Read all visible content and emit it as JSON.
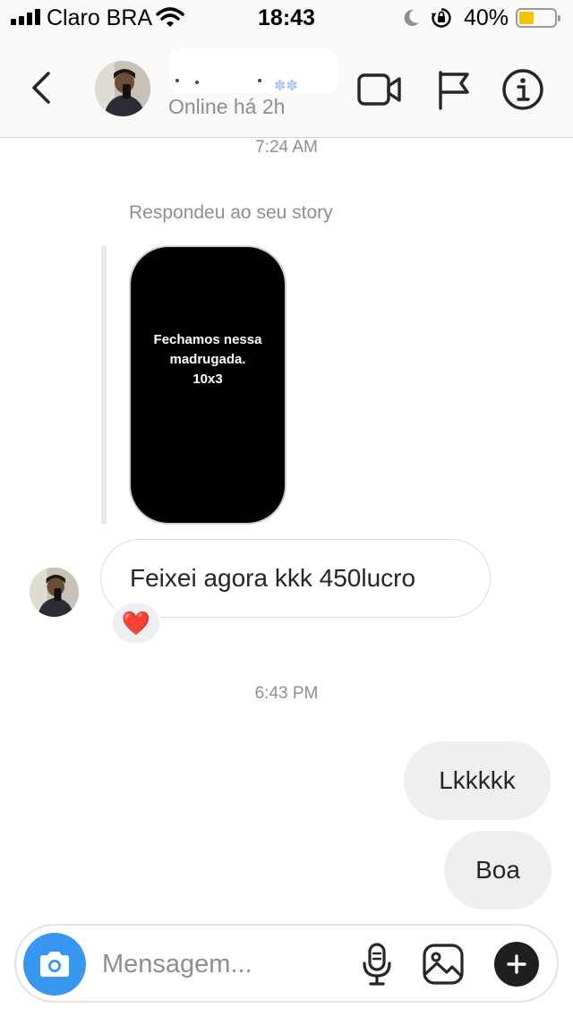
{
  "status_bar": {
    "carrier": "Claro BRA",
    "time": "18:43",
    "battery_percent": "40%",
    "battery_level": 0.4,
    "battery_color": "#f5c400",
    "icons": [
      "signal-icon",
      "wifi-icon",
      "moon-icon",
      "orientation-lock-icon",
      "battery-icon"
    ]
  },
  "header": {
    "presence": "Online há 2h",
    "icons": [
      "chevron-left-icon",
      "video-camera-icon",
      "flag-icon",
      "info-icon"
    ]
  },
  "chat": {
    "timestamp_1": "7:24 AM",
    "story_reply_label": "Respondeu ao seu story",
    "story_text": "Fechamos nessa\nmadrugada.\n10x3",
    "incoming_message": "Feixei agora kkk 450lucro",
    "reaction": "❤️",
    "timestamp_2": "6:43 PM",
    "outgoing_messages": [
      "Lkkkkk",
      "Boa"
    ]
  },
  "composer": {
    "placeholder": "Mensagem...",
    "accent_color": "#3797f0",
    "icons": [
      "camera-icon",
      "microphone-icon",
      "gallery-icon",
      "plus-icon"
    ]
  }
}
